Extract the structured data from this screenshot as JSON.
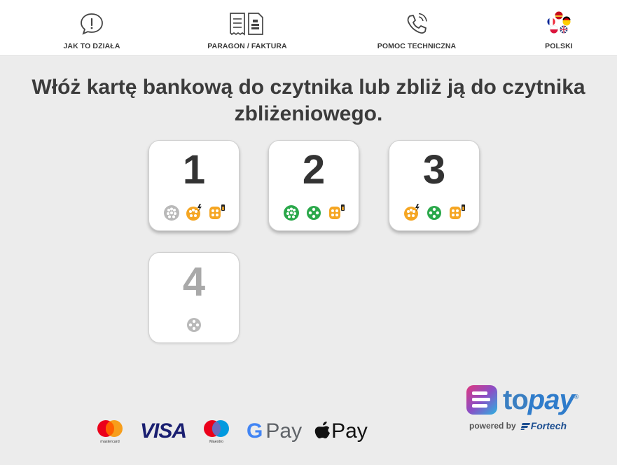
{
  "nav": {
    "how": {
      "label": "JAK TO DZIAŁA",
      "icon": "chat-info-icon"
    },
    "receipt": {
      "label": "PARAGON / FAKTURA",
      "icon": "receipt-invoice-icon"
    },
    "help": {
      "label": "POMOC TECHNICZNA",
      "icon": "phone-call-icon"
    },
    "language": {
      "label": "POLSKI",
      "icon": "language-flags-icon"
    }
  },
  "instruction": "Włóż kartę bankową do czytnika lub zbliż ją do czytnika zbliżeniowego.",
  "stations": [
    {
      "number": "1",
      "enabled": true,
      "connectors": [
        {
          "icon": "type2-connector-icon",
          "status": "unavailable",
          "color": "#b9b9b9"
        },
        {
          "icon": "ccs-fast-connector-icon",
          "status": "occupied",
          "color": "#f5a623"
        },
        {
          "icon": "chademo-connector-icon",
          "status": "occupied",
          "color": "#f5a623"
        }
      ]
    },
    {
      "number": "2",
      "enabled": true,
      "connectors": [
        {
          "icon": "type2-connector-icon",
          "status": "available",
          "color": "#2aa84a"
        },
        {
          "icon": "type2-small-connector-icon",
          "status": "available",
          "color": "#2aa84a"
        },
        {
          "icon": "chademo-connector-icon",
          "status": "occupied",
          "color": "#f5a623"
        }
      ]
    },
    {
      "number": "3",
      "enabled": true,
      "connectors": [
        {
          "icon": "ccs-fast-connector-icon",
          "status": "occupied",
          "color": "#f5a623"
        },
        {
          "icon": "type2-small-connector-icon",
          "status": "available",
          "color": "#2aa84a"
        },
        {
          "icon": "chademo-connector-icon",
          "status": "occupied",
          "color": "#f5a623"
        }
      ]
    },
    {
      "number": "4",
      "enabled": false,
      "connectors": [
        {
          "icon": "type2-small-connector-icon",
          "status": "unavailable",
          "color": "#b9b9b9"
        }
      ]
    }
  ],
  "payment": {
    "mastercard_caption": "mastercard",
    "visa": "VISA",
    "maestro_caption": "Maestro",
    "gpay_g": "G",
    "gpay_text": "Pay",
    "applepay_text": "Pay"
  },
  "brand": {
    "to": "to",
    "pay": "pay",
    "registered": "®",
    "powered_by": "powered by",
    "fortech": "Fortech"
  },
  "colors": {
    "available": "#2aa84a",
    "occupied": "#f5a623",
    "unavailable": "#b9b9b9",
    "brand_blue": "#3a7fc2",
    "brand_gradient": [
      "#e0377f",
      "#8a4fc6",
      "#2bb3e0"
    ]
  }
}
